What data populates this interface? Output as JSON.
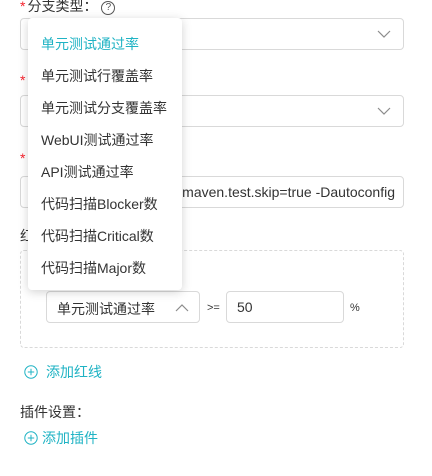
{
  "branch_type": {
    "label": "分支类型：",
    "help_icon": "?"
  },
  "obscured_asterisk": "*",
  "command_input": {
    "value": "Dmaven.test.skip=true -Dautoconfig"
  },
  "redline_label": "红",
  "redline": {
    "metric_value": "单元测试通过率",
    "operator": ">=",
    "threshold": "50",
    "unit": "%"
  },
  "add_redline": "添加红线",
  "plugin_settings_label": "插件设置：",
  "add_plugin": "添加插件",
  "dropdown": {
    "items": [
      {
        "label": "单元测试通过率",
        "active": true
      },
      {
        "label": "单元测试行覆盖率"
      },
      {
        "label": "单元测试分支覆盖率"
      },
      {
        "label": "WebUI测试通过率"
      },
      {
        "label": "API测试通过率"
      },
      {
        "label": "代码扫描Blocker数"
      },
      {
        "label": "代码扫描Critical数"
      },
      {
        "label": "代码扫描Major数"
      }
    ]
  },
  "colors": {
    "accent": "#1fb3c4",
    "required": "#f5222d",
    "border": "#d9d9d9"
  },
  "icons": {
    "chevron": "chevron-down-icon",
    "chevron_up": "chevron-up-icon",
    "plus": "plus-circle-icon",
    "help": "question-circle-icon"
  }
}
